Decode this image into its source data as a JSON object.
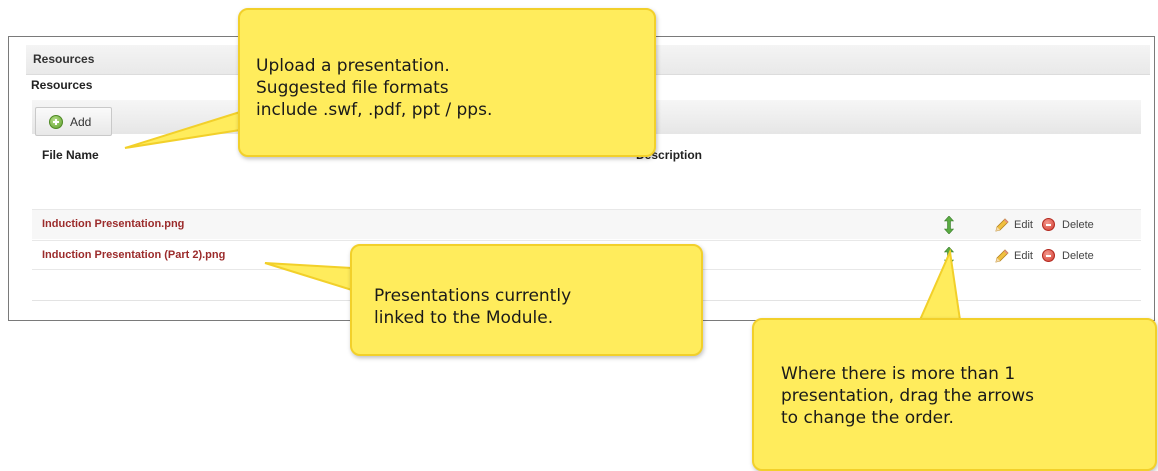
{
  "panel": {
    "title": "Resources",
    "section_title": "Resources",
    "toolbar": {
      "add_label": "Add"
    },
    "columns": {
      "file_name": "File Name",
      "description": "Description"
    },
    "rows": [
      {
        "file_name": "Induction Presentation.png",
        "description": "",
        "edit_label": "Edit",
        "delete_label": "Delete"
      },
      {
        "file_name": "Induction Presentation (Part 2).png",
        "description": "",
        "edit_label": "Edit",
        "delete_label": "Delete"
      }
    ]
  },
  "callouts": {
    "upload": {
      "lines": [
        "Upload a presentation.",
        "Suggested file formats",
        "include .swf, .pdf, ppt / pps."
      ]
    },
    "linked": {
      "lines": [
        "Presentations currently",
        "linked to the Module."
      ]
    },
    "order": {
      "lines": [
        "Where there is more than 1",
        "presentation, drag the arrows",
        "to change the order."
      ]
    }
  },
  "colors": {
    "callout_fill": "#ffec5c",
    "callout_border": "#f2d02a",
    "file_link": "#9b2b2b",
    "drag_arrow": "#4e9a3a"
  },
  "icons": {
    "add": "plus-circle-icon",
    "drag": "up-down-arrow-icon",
    "edit": "pencil-icon",
    "delete": "minus-circle-icon"
  }
}
